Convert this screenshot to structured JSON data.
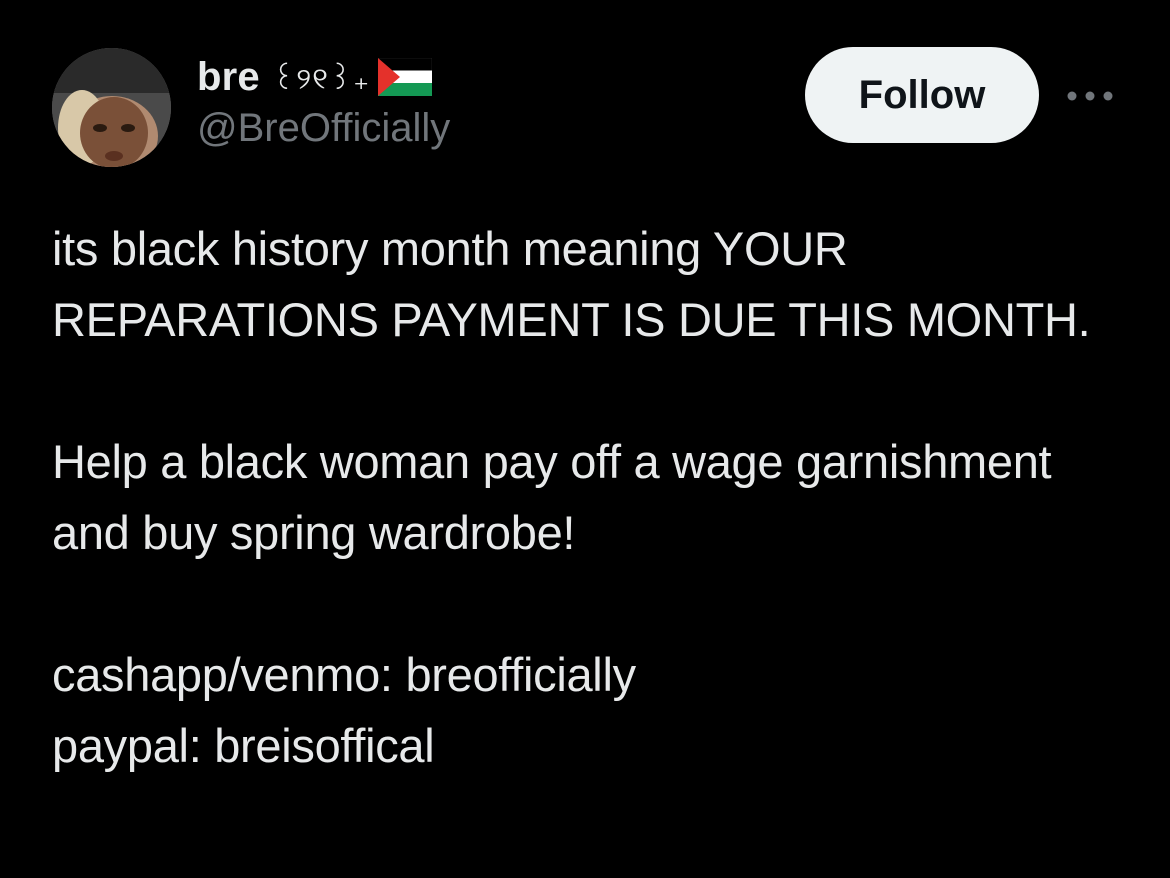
{
  "author": {
    "display_name": "bre",
    "name_decoration": "꒰୨୧꒱₊",
    "flag_icon": "palestine-flag-icon",
    "handle": "@BreOfficially",
    "avatar_icon": "profile-avatar"
  },
  "actions": {
    "follow_label": "Follow",
    "more_icon": "more-horizontal-icon"
  },
  "tweet": {
    "paragraph_1": "its black history month meaning YOUR REPARATIONS PAYMENT IS DUE THIS MONTH.",
    "paragraph_2": "Help a black woman pay off a wage garnishment and buy spring wardrobe!",
    "line_cashapp": "cashapp/venmo: breofficially",
    "line_paypal": "paypal: breisoffical"
  },
  "colors": {
    "background": "#000000",
    "primary_text": "#e7e9ea",
    "secondary_text": "#71767b",
    "follow_button_bg": "#eff3f4",
    "follow_button_text": "#0f1419",
    "flag_red": "#e4312b",
    "flag_black": "#000000",
    "flag_white": "#ffffff",
    "flag_green": "#149954"
  }
}
